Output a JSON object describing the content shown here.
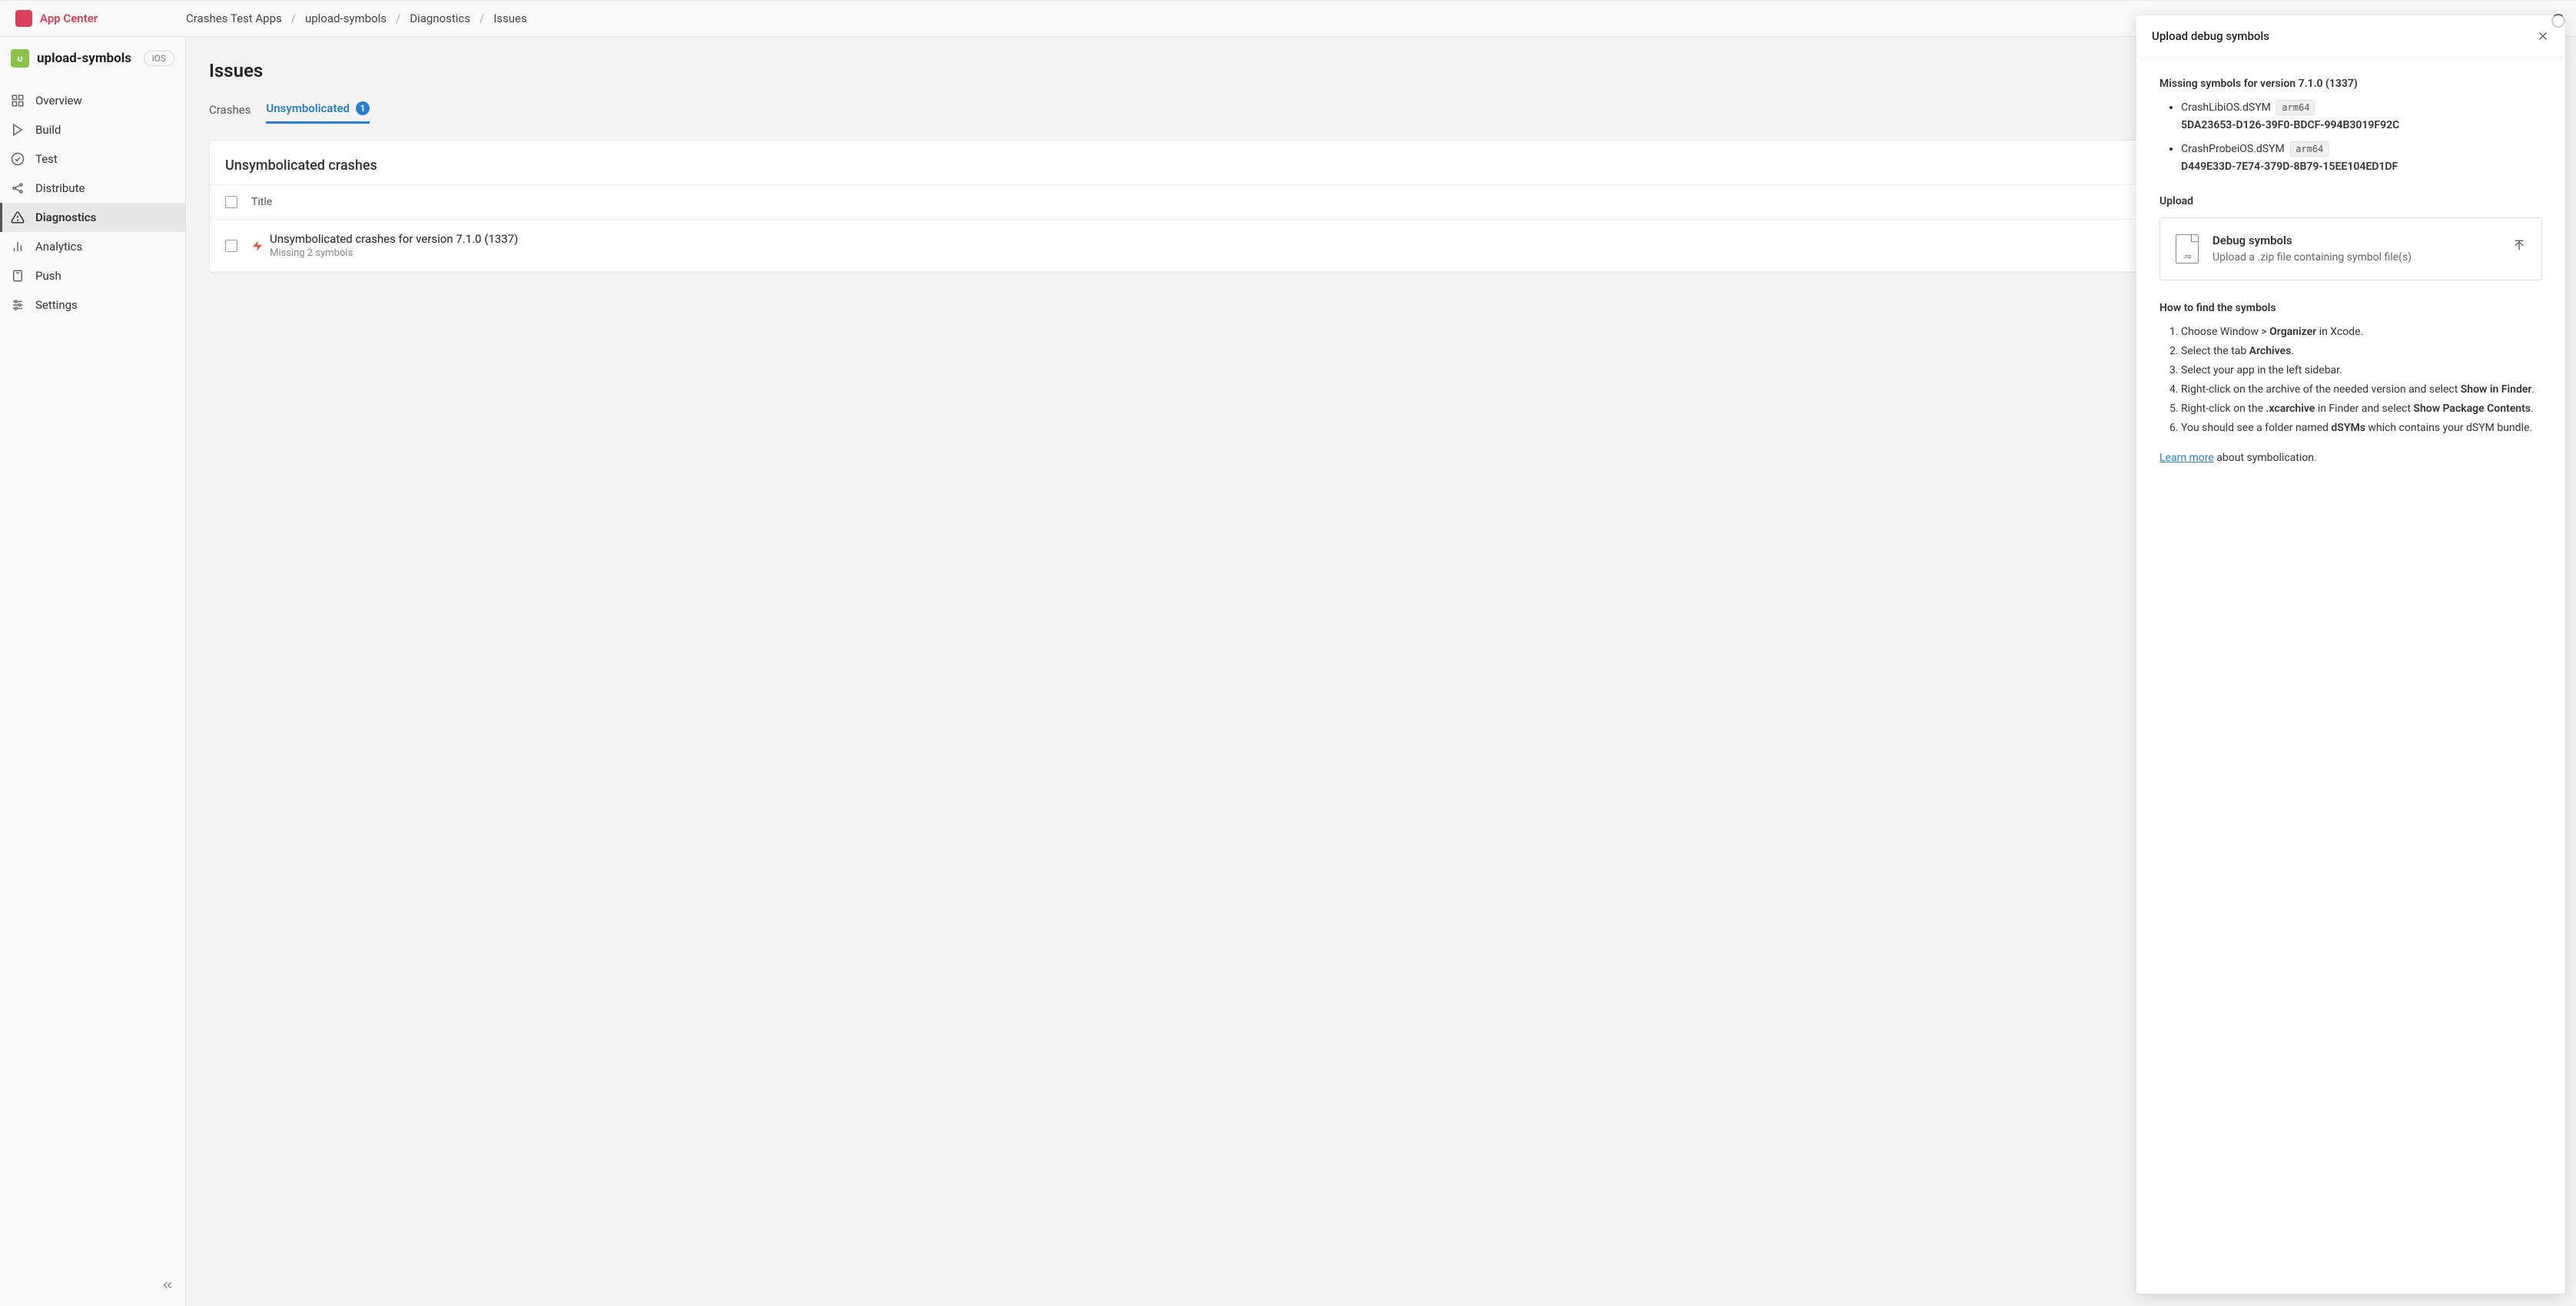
{
  "brand": "App Center",
  "breadcrumb": [
    "Crashes Test Apps",
    "upload-symbols",
    "Diagnostics",
    "Issues"
  ],
  "app": {
    "initial": "u",
    "name": "upload-symbols",
    "platform": "iOS"
  },
  "nav": {
    "overview": "Overview",
    "build": "Build",
    "test": "Test",
    "distribute": "Distribute",
    "diagnostics": "Diagnostics",
    "analytics": "Analytics",
    "push": "Push",
    "settings": "Settings"
  },
  "page": {
    "title": "Issues",
    "tabs": {
      "crashes": "Crashes",
      "unsymbolicated": "Unsymbolicated",
      "count": "1"
    }
  },
  "table": {
    "section_title": "Unsymbolicated crashes",
    "col_title": "Title",
    "row": {
      "title": "Unsymbolicated crashes for version 7.1.0 (1337)",
      "subtitle": "Missing 2 symbols"
    }
  },
  "panel": {
    "title": "Upload debug symbols",
    "missing_heading": "Missing symbols for version 7.1.0 (1337)",
    "symbols": [
      {
        "name": "CrashLibiOS.dSYM",
        "arch": "arm64",
        "uuid": "5DA23653-D126-39F0-BDCF-994B3019F92C"
      },
      {
        "name": "CrashProbeiOS.dSYM",
        "arch": "arm64",
        "uuid": "D449E33D-7E74-379D-8B79-15EE104ED1DF"
      }
    ],
    "upload_heading": "Upload",
    "upload_box": {
      "title": "Debug symbols",
      "subtitle": "Upload a .zip file containing symbol file(s)"
    },
    "howto_heading": "How to find the symbols",
    "howto": {
      "s1a": "Choose Window > ",
      "s1b": "Organizer",
      "s1c": " in Xcode.",
      "s2a": "Select the tab ",
      "s2b": "Archives",
      "s2c": ".",
      "s3": "Select your app in the left sidebar.",
      "s4a": "Right-click on the archive of the needed version and select ",
      "s4b": "Show in Finder",
      "s4c": ".",
      "s5a": "Right-click on the ",
      "s5b": ".xcarchive",
      "s5c": " in Finder and select ",
      "s5d": "Show Package Contents",
      "s5e": ".",
      "s6a": "You should see a folder named ",
      "s6b": "dSYMs",
      "s6c": " which contains your dSYM bundle."
    },
    "learn_more": "Learn more",
    "learn_more_suffix": " about symbolication."
  }
}
